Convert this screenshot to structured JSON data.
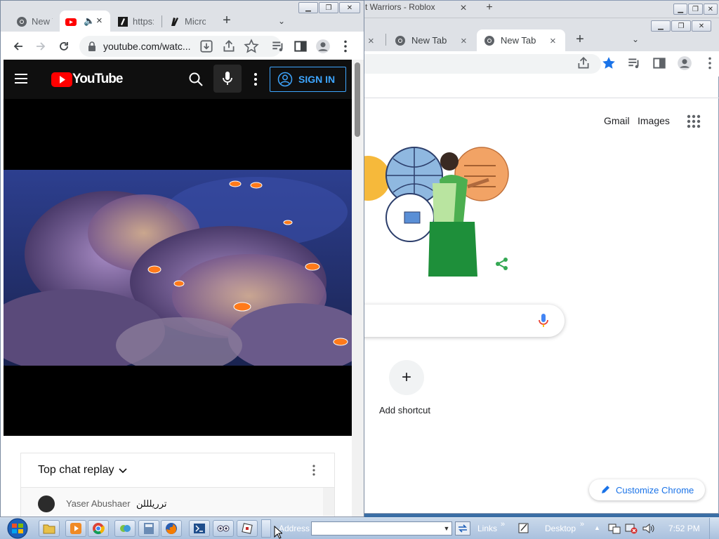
{
  "back_window": {
    "title_text": "t Warriors - Roblox",
    "tabs": [
      {
        "label": ""
      },
      {
        "label": "New Tab"
      },
      {
        "label": "New Tab"
      }
    ],
    "top_links": {
      "gmail": "Gmail",
      "images": "Images"
    },
    "add_shortcut": {
      "plus": "+",
      "label": "Add shortcut"
    },
    "customize_label": "Customize Chrome"
  },
  "front_window": {
    "tabs": [
      {
        "label": "New T"
      },
      {
        "label": ""
      },
      {
        "label": "https:"
      },
      {
        "label": "Micro"
      }
    ],
    "url": "youtube.com/watc...",
    "youtube": {
      "logo_text": "YouTube",
      "signin_label": "SIGN IN",
      "chat": {
        "title": "Top chat replay",
        "messages": [
          {
            "author": "Yaser Abushaer",
            "text": "ترريلللن"
          }
        ]
      }
    }
  },
  "taskbar": {
    "address_label": "Address",
    "address_value": "",
    "links_label": "Links",
    "desktop_label": "Desktop",
    "chevron": "»",
    "clock": "7:52 PM"
  },
  "colors": {
    "chrome_tabstrip": "#dee1e6",
    "youtube_red": "#ff0000",
    "youtube_dark": "#0f0f0f",
    "signin_blue": "#3ea6ff",
    "google_blue": "#1a73e8",
    "taskbar": "#aac1de"
  }
}
